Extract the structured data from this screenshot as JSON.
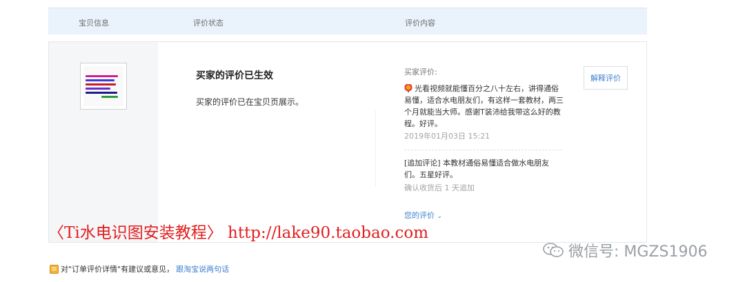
{
  "header": {
    "col_item": "宝贝信息",
    "col_status": "评价状态",
    "col_content": "评价内容"
  },
  "status": {
    "title": "买家的评价已生效",
    "text": "买家的评价已在宝贝页展示。"
  },
  "review": {
    "buyer_label": "买家评价:",
    "body": "光看视频就能懂百分之八十左右，讲得通俗易懂，适合水电朋友们，有这样一套教材，两三个月就能当大师。感谢T装沛给我带这么好的教程。好评。",
    "date": "2019年01月03日 15:21",
    "append": "[追加评论] 本教材通俗易懂适合做水电朋友们。五星好评。",
    "append_time": "确认收货后 1 天追加",
    "your_review": "您的评价",
    "explain_button": "解释评价"
  },
  "watermark": "〈Ti水电识图安装教程〉 http://lake90.taobao.com",
  "wechat": "微信号: MGZS1906",
  "footer": {
    "text": "对\"订单评价详情\"有建议或意见，",
    "link": "跟淘宝说两句话"
  },
  "icons": {
    "flower": "flower-icon",
    "chevron": "chevron-down-icon",
    "feedback": "feedback-icon",
    "wechat": "wechat-icon"
  },
  "colors": {
    "link": "#3e7fd0",
    "watermark": "#e21e1e",
    "header_bg": "#eaf3fb"
  }
}
